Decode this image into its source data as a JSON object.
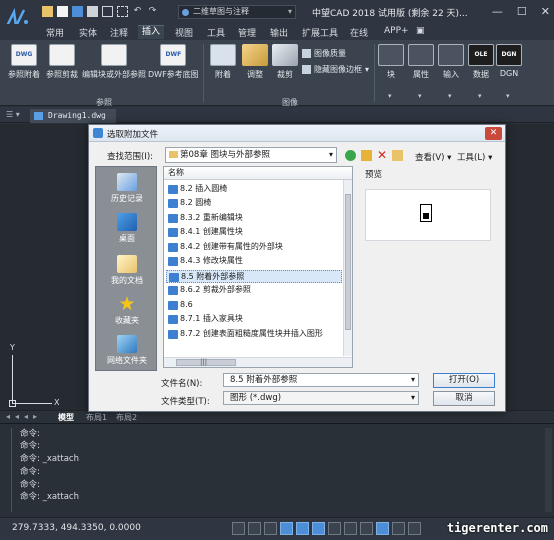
{
  "titlebar": {
    "workspace": "二维草图与注释",
    "app_title": "中望CAD 2018 试用版 (剩余 22 天)...",
    "minimize": "—",
    "restore": "☐",
    "close": "✕"
  },
  "menu": {
    "tabs": [
      "常用",
      "实体",
      "注释",
      "插入",
      "视图",
      "工具",
      "管理",
      "输出",
      "扩展工具",
      "在线",
      "APP+",
      "▣"
    ],
    "active": "插入"
  },
  "ribbon": {
    "reference": {
      "label": "参照",
      "buttons": [
        "参照附着",
        "参照剪裁",
        "编辑块或外部参照",
        "DWF参考底图"
      ],
      "icon_texts": [
        "DWG",
        "",
        "",
        "DWF"
      ]
    },
    "image": {
      "label": "图像",
      "buttons": [
        "附着",
        "调整",
        "裁剪"
      ],
      "small": [
        "图像质量",
        "隐藏图像边框"
      ]
    },
    "others": [
      {
        "label": "块",
        "icon": "block-icon"
      },
      {
        "label": "属性",
        "icon": "attribute-icon"
      },
      {
        "label": "输入",
        "icon": "import-icon"
      },
      {
        "label": "数据",
        "icon": "database-icon",
        "icon_text": "OLE"
      },
      {
        "label": "DGN",
        "icon": "dgn-icon",
        "icon_text": "DGN"
      }
    ]
  },
  "document": {
    "tab": "Drawing1.dwg",
    "tab_menu": "☰ ▾"
  },
  "layout_tabs": {
    "nav": "◂◂◂▸",
    "tabs": [
      "模型",
      "布局1",
      "布局2"
    ],
    "active": "模型"
  },
  "axes": {
    "x": "X",
    "y": "Y"
  },
  "command": {
    "lines": [
      "命令:",
      "命令:",
      "命令: _xattach",
      "命令:",
      "命令:",
      "命令: _xattach"
    ]
  },
  "status": {
    "coords": "279.7333, 494.3350, 0.0000",
    "watermark": "tigerenter.com"
  },
  "dialog": {
    "title": "选取附加文件",
    "close": "✕",
    "lookin_label": "查找范围(I):",
    "lookin_value": "第08章 图块与外部参照",
    "toolbar": {
      "view": "查看(V)",
      "tools": "工具(L)",
      "delete": "✕"
    },
    "places": [
      "历史记录",
      "桌面",
      "我的文档",
      "收藏夹",
      "网络文件夹"
    ],
    "list_header": "名称",
    "files": [
      "8.2  插入圆椅",
      "8.2  圆椅",
      "8.3.2   重新编辑块",
      "8.4.1  创建属性块",
      "8.4.2  创建带有属性的外部块",
      "8.4.3  修改块属性",
      "8.5  附着外部参照",
      "8.6.2 剪裁外部参照",
      "8.6",
      "8.7.1  插入家具块",
      "8.7.2  创建表面粗糙度属性块并插入图形"
    ],
    "selected_index": 6,
    "preview_label": "预览",
    "filename_label": "文件名(N):",
    "filename_value": "8.5  附着外部参照",
    "filetype_label": "文件类型(T):",
    "filetype_value": "图形 (*.dwg)",
    "open": "打开(O)",
    "cancel": "取消",
    "hscroll_mark": "|||"
  }
}
